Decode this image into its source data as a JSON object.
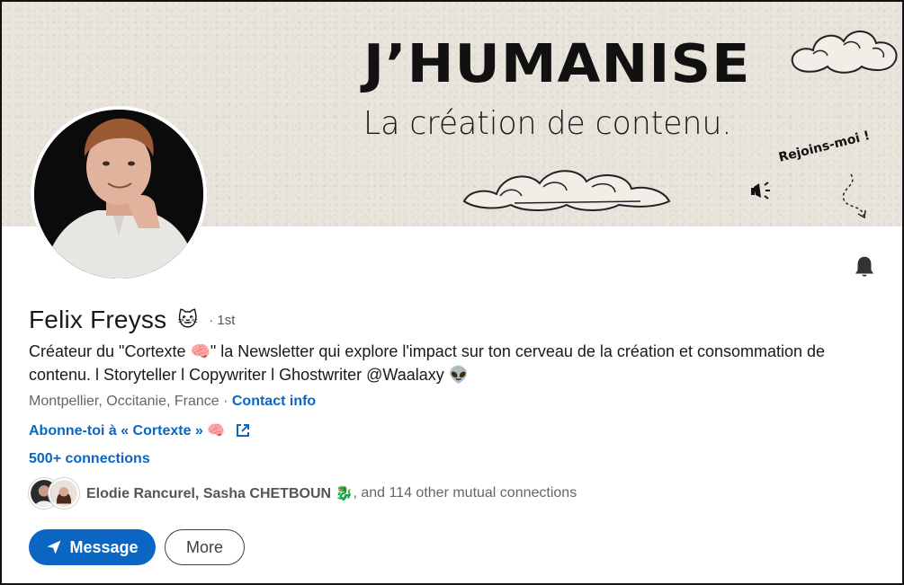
{
  "banner": {
    "title": "J’HUMANISE",
    "subtitle": "La création de contenu.",
    "cta": "Rejoins-moi !"
  },
  "profile": {
    "name": "Felix Freyss",
    "name_emoji": "🐱",
    "degree": "· 1st",
    "headline": "Créateur du \"Cortexte 🧠\" la Newsletter qui explore l'impact sur ton cerveau de la création et consommation de contenu. l Storyteller l Copywriter l Ghostwriter @Waalaxy 👽",
    "location": "Montpellier, Occitanie, France ·",
    "contact_info": "Contact info",
    "newsletter_link": "Abonne-toi à « Cortexte » 🧠",
    "connections": "500+ connections",
    "mutual_names": "Elodie Rancurel, Sasha CHETBOUN 🐉",
    "mutual_rest": ", and 114 other mutual connections"
  },
  "actions": {
    "message_label": "Message",
    "more_label": "More"
  },
  "icons": {
    "bell": "bell-icon",
    "send": "paper-plane-icon",
    "external": "external-link-icon"
  },
  "colors": {
    "accent": "#0a66c2",
    "banner_bg": "#e9e4dc"
  }
}
